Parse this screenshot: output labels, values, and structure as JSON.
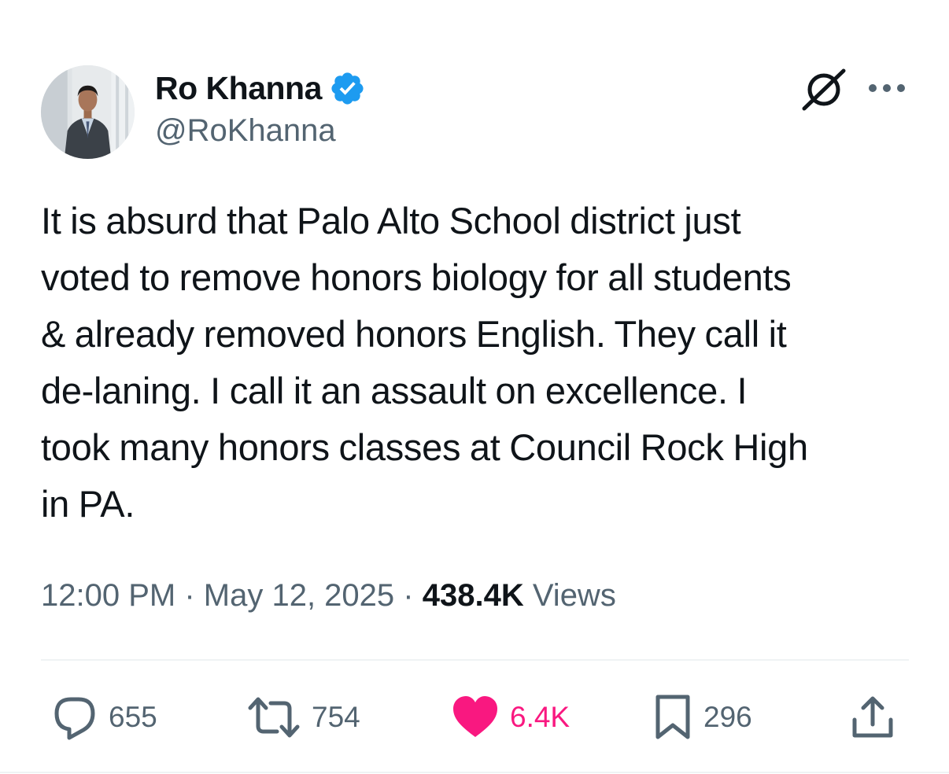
{
  "author": {
    "display_name": "Ro Khanna",
    "handle": "@RoKhanna",
    "verified": true,
    "verified_color": "#1d9bf0"
  },
  "tweet": {
    "lines": [
      "It is absurd that Palo Alto School district just",
      "voted to remove honors biology for all students",
      "& already removed honors English. They call it",
      "de-laning. I call it an assault on excellence. I",
      "took many honors classes at Council Rock High",
      "in PA."
    ]
  },
  "meta": {
    "time": "12:00 PM",
    "separator": "·",
    "date": "May 12, 2025",
    "views_count": "438.4K",
    "views_label": "Views"
  },
  "actions": {
    "replies": "655",
    "reposts": "754",
    "likes": "6.4K",
    "bookmarks": "296"
  },
  "icons": {
    "header": [
      "grok-icon",
      "more-options-icon"
    ],
    "actions": [
      "reply-icon",
      "repost-icon",
      "like-icon",
      "bookmark-icon",
      "share-icon"
    ]
  },
  "colors": {
    "text_primary": "#0f1419",
    "text_secondary": "#536471",
    "like_pink": "#f91880",
    "divider": "#eff3f4"
  }
}
